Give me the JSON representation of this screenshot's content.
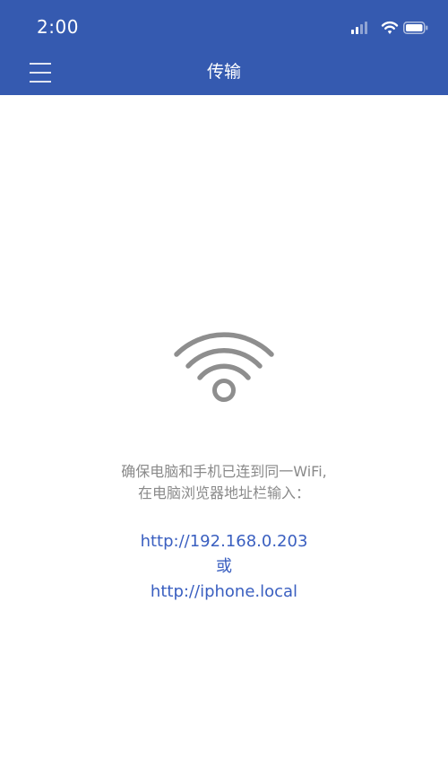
{
  "status_bar": {
    "time": "2:00"
  },
  "nav": {
    "title": "传输",
    "menu_icon": "hamburger-menu-icon"
  },
  "transfer": {
    "icon": "wifi-icon",
    "instruction_line1": "确保电脑和手机已连到同一WiFi,",
    "instruction_line2": "在电脑浏览器地址栏输入：",
    "url_ip": "http://192.168.0.203",
    "or_label": "或",
    "url_host": "http://iphone.local"
  },
  "colors": {
    "header_bg": "#355ab0",
    "link": "#3a5fc0",
    "instruction_text": "#8a8a8a",
    "wifi_icon": "#8e8e8e"
  }
}
